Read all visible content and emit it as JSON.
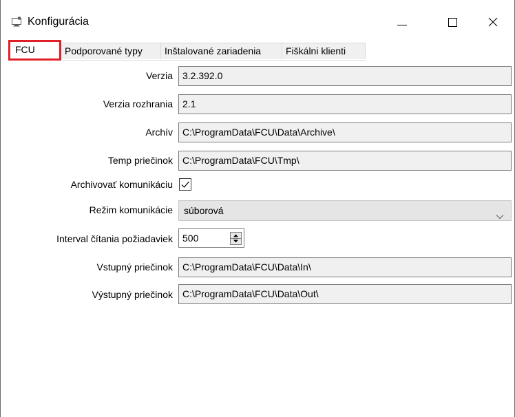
{
  "window": {
    "title": "Konfigurácia",
    "minimize_glyph": "—",
    "maximize_glyph": "☐",
    "close_glyph": "✕"
  },
  "tabs": [
    {
      "label": "FCU",
      "active": true
    },
    {
      "label": "Podporované typy",
      "active": false
    },
    {
      "label": "Inštalované zariadenia",
      "active": false
    },
    {
      "label": "Fiškálni klienti",
      "active": false
    }
  ],
  "form": {
    "verzia": {
      "label": "Verzia",
      "value": "3.2.392.0"
    },
    "verzia_rozhrania": {
      "label": "Verzia rozhrania",
      "value": "2.1"
    },
    "archiv": {
      "label": "Archív",
      "value": "C:\\ProgramData\\FCU\\Data\\Archive\\"
    },
    "temp": {
      "label": "Temp priečinok",
      "value": "C:\\ProgramData\\FCU\\Tmp\\"
    },
    "archivovat": {
      "label": "Archivovať komunikáciu",
      "checked": true
    },
    "rezim": {
      "label": "Režim komunikácie",
      "value": "súborová"
    },
    "interval": {
      "label": "Interval čítania požiadaviek",
      "value": "500"
    },
    "vstupny": {
      "label": "Vstupný priečinok",
      "value": "C:\\ProgramData\\FCU\\Data\\In\\"
    },
    "vystupny": {
      "label": "Výstupný priečinok",
      "value": "C:\\ProgramData\\FCU\\Data\\Out\\"
    }
  },
  "colors": {
    "highlight_border": "#e01f26",
    "field_background": "#f0f0f0",
    "select_background": "#e5e5e5"
  },
  "icons": {
    "app": "window-app-icon",
    "minimize": "minimize-icon",
    "maximize": "maximize-icon",
    "close": "close-icon",
    "checkbox": "checkmark-icon",
    "dropdown": "chevron-down-icon",
    "spinner": "spinner-up-down-icon"
  }
}
